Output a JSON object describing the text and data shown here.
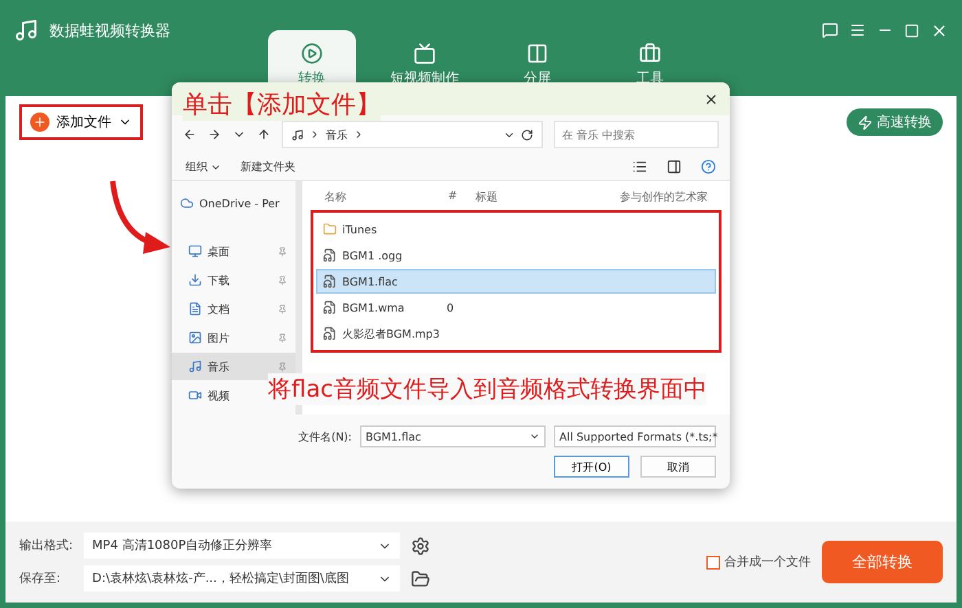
{
  "window": {
    "title": "数据蛙视频转换器"
  },
  "tabs": [
    {
      "label": "转换",
      "selected": true
    },
    {
      "label": "短视频制作",
      "selected": false
    },
    {
      "label": "分屏",
      "selected": false
    },
    {
      "label": "工具",
      "selected": false
    }
  ],
  "toolbar": {
    "add_file": "添加文件",
    "fast_convert": "高速转换"
  },
  "dialog": {
    "address": "音乐",
    "search": {
      "placeholder": "在 音乐 中搜索"
    },
    "commands": [
      "组织",
      "新建文件夹"
    ],
    "nav_items": [
      {
        "label": "OneDrive - Per",
        "kind": "cloud",
        "selected": false,
        "pinned": false
      },
      {
        "label": "桌面",
        "kind": "desktop",
        "selected": false,
        "pinned": true
      },
      {
        "label": "下载",
        "kind": "download",
        "selected": false,
        "pinned": true
      },
      {
        "label": "文档",
        "kind": "docs",
        "selected": false,
        "pinned": true
      },
      {
        "label": "图片",
        "kind": "pictures",
        "selected": false,
        "pinned": true
      },
      {
        "label": "音乐",
        "kind": "music",
        "selected": true,
        "pinned": true
      },
      {
        "label": "视频",
        "kind": "video",
        "selected": false,
        "pinned": false
      }
    ],
    "columns": [
      "名称",
      "#",
      "标题",
      "参与创作的艺术家"
    ],
    "files": [
      {
        "name": "iTunes",
        "kind": "folder",
        "selected": false
      },
      {
        "name": "BGM1 .ogg",
        "kind": "audio",
        "selected": false
      },
      {
        "name": "BGM1.flac",
        "kind": "audio",
        "selected": true
      },
      {
        "name": "BGM1.wma",
        "kind": "audio",
        "number": "0",
        "selected": false
      },
      {
        "name": "火影忍者BGM.mp3",
        "kind": "audio",
        "selected": false
      }
    ],
    "filename_label": "文件名(N):",
    "filename": "BGM1.flac",
    "filter": "All Supported Formats (*.ts;*",
    "open_button": "打开(O)",
    "cancel_button": "取消"
  },
  "annotations": [
    {
      "text": "单击【添加文件】",
      "kind": "top"
    },
    {
      "text": "将flac音频文件导入到音频格式转换界面中",
      "kind": "bottom"
    }
  ],
  "bottom": {
    "format_label": "输出格式:",
    "format": "MP4 高清1080P自动修正分辨率",
    "save_label": "保存至:",
    "save_path": "D:\\袁林炫\\袁林炫-产...，轻松搞定\\封面图\\底图",
    "merge": {
      "label": "合并成一个文件",
      "checked": false
    },
    "convert_all": "全部转换"
  }
}
